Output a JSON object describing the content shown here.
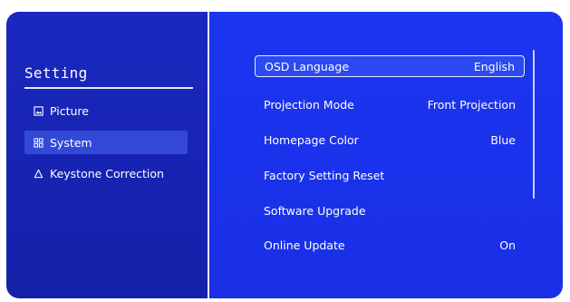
{
  "sidebar": {
    "title": "Setting",
    "items": [
      {
        "label": "Picture",
        "icon": "picture-icon"
      },
      {
        "label": "System",
        "icon": "system-icon"
      },
      {
        "label": "Keystone Correction",
        "icon": "keystone-icon"
      }
    ]
  },
  "main": {
    "rows": [
      {
        "label": "OSD Language",
        "value": "English"
      },
      {
        "label": "Projection Mode",
        "value": "Front Projection"
      },
      {
        "label": "Homepage Color",
        "value": "Blue"
      },
      {
        "label": "Factory Setting Reset",
        "value": ""
      },
      {
        "label": "Software Upgrade",
        "value": ""
      },
      {
        "label": "Online Update",
        "value": "On"
      }
    ]
  },
  "colors": {
    "sidebar_bg": "#1a28bf",
    "main_bg": "#1b35f0",
    "selected_sidebar": "#3349d6",
    "text": "#ffffff"
  }
}
